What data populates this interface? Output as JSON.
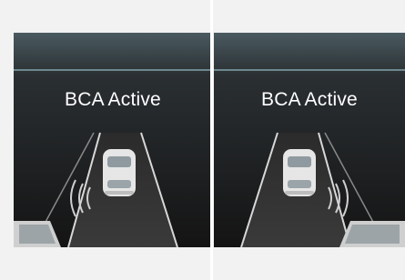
{
  "panels": [
    {
      "side": "left",
      "status_text": "BCA Active",
      "sensor_side": "left",
      "adjacent_car_side": "left"
    },
    {
      "side": "right",
      "status_text": "BCA Active",
      "sensor_side": "right",
      "adjacent_car_side": "right"
    }
  ],
  "colors": {
    "screen_bg": "#1b1b1b",
    "header_bg": "#f2f2f2",
    "text": "#ffffff",
    "road_line": "#d8d8d8",
    "wave": "#cfcfcf"
  }
}
